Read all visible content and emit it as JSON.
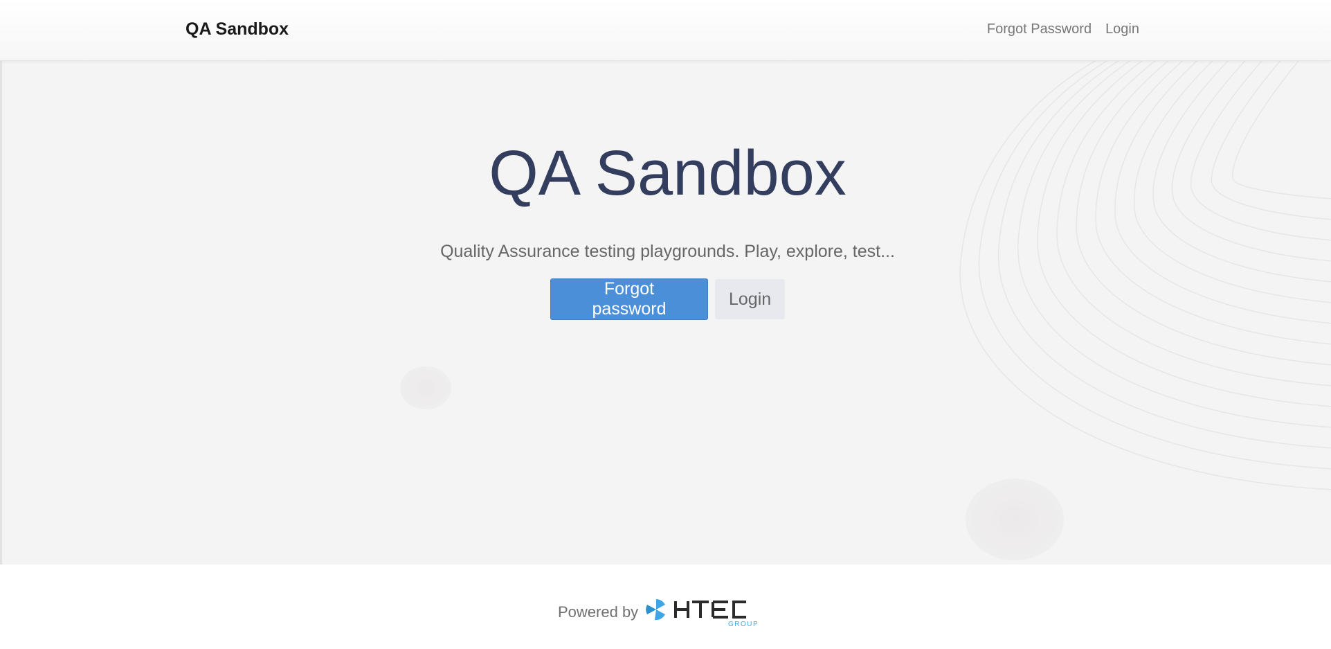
{
  "navbar": {
    "brand": "QA Sandbox",
    "links": [
      "Forgot Password",
      "Login"
    ]
  },
  "hero": {
    "title": "QA Sandbox",
    "subtitle": "Quality Assurance testing playgrounds. Play, explore, test...",
    "primary_button": "Forgot password",
    "secondary_button": "Login"
  },
  "footer": {
    "powered_by": "Powered by",
    "logo_text": "HTEC",
    "logo_subtext": "GROUP"
  },
  "colors": {
    "primary": "#4a8fd8",
    "title": "#333d5e",
    "hero_bg": "#f4f4f4",
    "logo_blue": "#3ea6e6"
  }
}
